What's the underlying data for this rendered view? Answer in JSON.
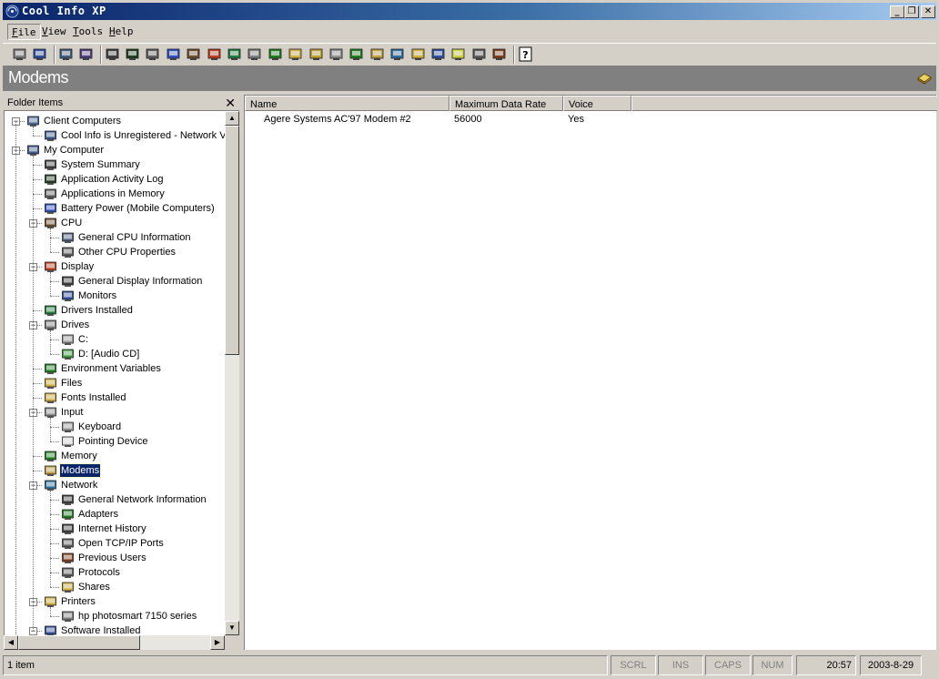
{
  "window": {
    "title": "Cool Info XP",
    "caption_buttons": {
      "minimize": "_",
      "maximize": "❐",
      "close": "✕"
    }
  },
  "menu": [
    {
      "label": "File",
      "underline": "F",
      "rest": "ile",
      "active": true
    },
    {
      "label": "View",
      "underline": "V",
      "rest": "iew",
      "active": false
    },
    {
      "label": "Tools",
      "underline": "T",
      "rest": "ools",
      "active": false
    },
    {
      "label": "Help",
      "underline": "H",
      "rest": "elp",
      "active": false
    }
  ],
  "toolbar": {
    "icons": [
      "print-icon",
      "network-connect-icon",
      "edit-script-icon",
      "run-script-icon",
      "computer-icon",
      "app-log-icon",
      "apps-memory-icon",
      "battery-icon",
      "cpu-icon",
      "display-icon",
      "drivers-icon",
      "drives-icon",
      "env-vars-icon",
      "files-icon",
      "fonts-icon",
      "input-icon",
      "memory-icon",
      "modem-icon",
      "network-icon",
      "printer-icon",
      "software-icon",
      "sound-icon",
      "system-icon",
      "users-icon",
      "help-icon"
    ]
  },
  "page_header": {
    "title": "Modems",
    "icon": "modem-icon"
  },
  "folder_pane": {
    "title": "Folder Items",
    "close": "✕",
    "tree": [
      {
        "label": "Client Computers",
        "level": 0,
        "expander": "−",
        "icon": "client-computers-icon",
        "color": "#4a6aa0"
      },
      {
        "label": "Cool Info is Unregistered - Network V",
        "level": 1,
        "icon": "network-computer-icon",
        "color": "#3a5a90"
      },
      {
        "label": "My Computer",
        "level": 0,
        "expander": "−",
        "icon": "my-computer-icon",
        "color": "#3a5a90"
      },
      {
        "label": "System Summary",
        "level": 1,
        "icon": "computer-icon",
        "color": "#404040"
      },
      {
        "label": "Application Activity Log",
        "level": 1,
        "icon": "app-log-icon",
        "color": "#204020"
      },
      {
        "label": "Applications in Memory",
        "level": 1,
        "icon": "apps-memory-icon",
        "color": "#606060"
      },
      {
        "label": "Battery Power (Mobile Computers)",
        "level": 1,
        "icon": "battery-icon",
        "color": "#3050c0"
      },
      {
        "label": "CPU",
        "level": 1,
        "expander": "−",
        "icon": "cpu-icon",
        "color": "#705030"
      },
      {
        "label": "General CPU Information",
        "level": 2,
        "icon": "cpu-info-icon",
        "color": "#506080"
      },
      {
        "label": "Other CPU Properties",
        "level": 2,
        "icon": "cpu-props-icon",
        "color": "#606060"
      },
      {
        "label": "Display",
        "level": 1,
        "expander": "−",
        "icon": "display-icon",
        "color": "#c04020"
      },
      {
        "label": "General Display Information",
        "level": 2,
        "icon": "display-info-icon",
        "color": "#404040"
      },
      {
        "label": "Monitors",
        "level": 2,
        "icon": "monitor-icon",
        "color": "#3050a0"
      },
      {
        "label": "Drivers Installed",
        "level": 1,
        "icon": "drivers-icon",
        "color": "#208040"
      },
      {
        "label": "Drives",
        "level": 1,
        "expander": "−",
        "icon": "drives-icon",
        "color": "#808080"
      },
      {
        "label": "C:",
        "level": 2,
        "icon": "hard-drive-icon",
        "color": "#a0a0a0"
      },
      {
        "label": "D: [Audio CD]",
        "level": 2,
        "icon": "cd-drive-icon",
        "color": "#40a040"
      },
      {
        "label": "Environment Variables",
        "level": 1,
        "icon": "env-vars-icon",
        "color": "#208020"
      },
      {
        "label": "Files",
        "level": 1,
        "icon": "files-icon",
        "color": "#d0b040"
      },
      {
        "label": "Fonts Installed",
        "level": 1,
        "icon": "fonts-icon",
        "color": "#d0b040"
      },
      {
        "label": "Input",
        "level": 1,
        "expander": "−",
        "icon": "input-icon",
        "color": "#909090"
      },
      {
        "label": "Keyboard",
        "level": 2,
        "icon": "keyboard-icon",
        "color": "#a0a0a0"
      },
      {
        "label": "Pointing Device",
        "level": 2,
        "icon": "mouse-icon",
        "color": "#e0e0e0"
      },
      {
        "label": "Memory",
        "level": 1,
        "icon": "memory-icon",
        "color": "#208020"
      },
      {
        "label": "Modems",
        "level": 1,
        "icon": "modem-icon",
        "color": "#c0a040",
        "selected": true
      },
      {
        "label": "Network",
        "level": 1,
        "expander": "−",
        "icon": "network-icon",
        "color": "#3070a0"
      },
      {
        "label": "General Network Information",
        "level": 2,
        "icon": "network-info-icon",
        "color": "#404040"
      },
      {
        "label": "Adapters",
        "level": 2,
        "icon": "adapter-icon",
        "color": "#208020"
      },
      {
        "label": "Internet History",
        "level": 2,
        "icon": "history-icon",
        "color": "#404040"
      },
      {
        "label": "Open TCP/IP Ports",
        "level": 2,
        "icon": "ports-icon",
        "color": "#606060"
      },
      {
        "label": "Previous Users",
        "level": 2,
        "icon": "users-icon",
        "color": "#804020"
      },
      {
        "label": "Protocols",
        "level": 2,
        "icon": "protocols-icon",
        "color": "#606060"
      },
      {
        "label": "Shares",
        "level": 2,
        "icon": "shares-icon",
        "color": "#d0b040"
      },
      {
        "label": "Printers",
        "level": 1,
        "expander": "−",
        "icon": "printers-icon",
        "color": "#d0b040"
      },
      {
        "label": "hp photosmart 7150 series",
        "level": 2,
        "icon": "printer-icon",
        "color": "#808080"
      },
      {
        "label": "Software Installed",
        "level": 1,
        "expander": "−",
        "icon": "software-icon",
        "color": "#3050a0"
      }
    ]
  },
  "list": {
    "columns": [
      "Name",
      "Maximum Data Rate",
      "Voice"
    ],
    "rows": [
      [
        "Agere Systems AC'97 Modem #2",
        "56000",
        "Yes"
      ]
    ]
  },
  "status": {
    "count": "1 item",
    "scrl": "SCRL",
    "ins": "INS",
    "caps": "CAPS",
    "num": "NUM",
    "time": "20:57",
    "date": "2003-8-29"
  },
  "colors": {
    "title_start": "#0a246a",
    "title_end": "#a6caf0",
    "face": "#d4d0c8",
    "header_gray": "#808080",
    "selection": "#0a246a"
  }
}
